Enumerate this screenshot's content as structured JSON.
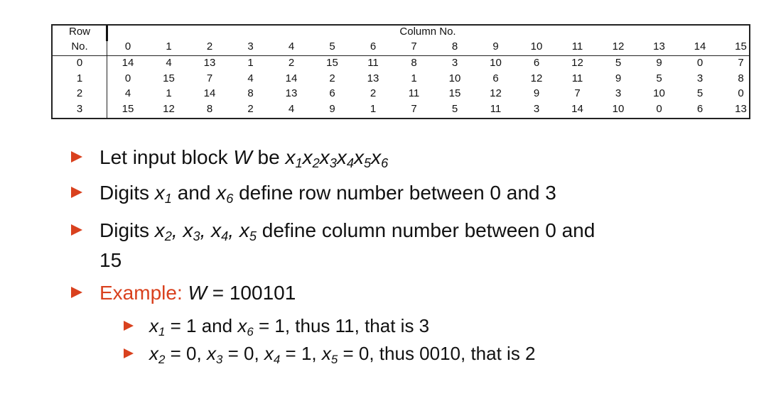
{
  "table": {
    "row_header": [
      "Row",
      "No."
    ],
    "column_header": "Column No.",
    "columns": [
      "0",
      "1",
      "2",
      "3",
      "4",
      "5",
      "6",
      "7",
      "8",
      "9",
      "10",
      "11",
      "12",
      "13",
      "14",
      "15"
    ],
    "rows": [
      {
        "label": "0",
        "values": [
          "14",
          "4",
          "13",
          "1",
          "2",
          "15",
          "11",
          "8",
          "3",
          "10",
          "6",
          "12",
          "5",
          "9",
          "0",
          "7"
        ]
      },
      {
        "label": "1",
        "values": [
          "0",
          "15",
          "7",
          "4",
          "14",
          "2",
          "13",
          "1",
          "10",
          "6",
          "12",
          "11",
          "9",
          "5",
          "3",
          "8"
        ]
      },
      {
        "label": "2",
        "values": [
          "4",
          "1",
          "14",
          "8",
          "13",
          "6",
          "2",
          "11",
          "15",
          "12",
          "9",
          "7",
          "3",
          "10",
          "5",
          "0"
        ]
      },
      {
        "label": "3",
        "values": [
          "15",
          "12",
          "8",
          "2",
          "4",
          "9",
          "1",
          "7",
          "5",
          "11",
          "3",
          "14",
          "10",
          "0",
          "6",
          "13"
        ]
      }
    ]
  },
  "bullets": {
    "b1": {
      "text": "Let input block ",
      "var": "W",
      "mid": " be ",
      "expr": "x1x2x3x4x5x6"
    },
    "b2": {
      "a": "Digits ",
      "x1": "x1",
      "and": " and ",
      "x6": "x6",
      "rest": " define row number between 0 and 3"
    },
    "b3": {
      "a": "Digits ",
      "vars": "x2, x3, x4, x5",
      "rest": " define column number between 0 and",
      "cont": "15"
    },
    "b4": {
      "label": "Example: ",
      "var": "W",
      "eq": " = 100101"
    },
    "s1": {
      "text": " = 1 and ",
      "text2": " = 1, thus 11, that is 3"
    },
    "s2": {
      "text": "x2 = 0, x3 = 0, x4 = 1, x5 = 0, thus 0010, that is 2"
    }
  },
  "colors": {
    "accent": "#d9411e"
  }
}
